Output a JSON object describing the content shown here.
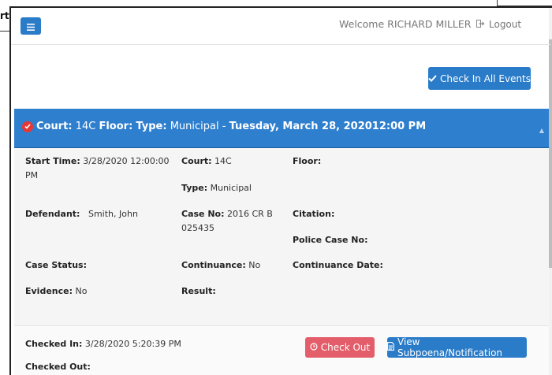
{
  "background": {
    "tab_fragment": "rt"
  },
  "header": {
    "welcome": "Welcome RICHARD MILLER",
    "logout_label": "Logout"
  },
  "actions": {
    "check_in_all": "Check In All Events"
  },
  "event": {
    "court_label": "Court:",
    "court": "14C",
    "floor_label": "Floor:",
    "type_label": "Type:",
    "type": "Municipal",
    "separator": "-",
    "datetime": "Tuesday, March 28, 202012:00 PM",
    "status_color": "#e53935"
  },
  "details": {
    "start_time_label": "Start Time:",
    "start_time_value": "3/28/2020  12:00:00",
    "start_time_value_2": "PM",
    "court_label": "Court:",
    "court_value": "14C",
    "floor_label": "Floor:",
    "type_label": "Type:",
    "type_value": "Municipal",
    "defendant_label": "Defendant:",
    "defendant_value": "Smith, John",
    "case_no_label": "Case No:",
    "case_no_value": "2016 CR B",
    "case_no_value_2": "025435",
    "citation_label": "Citation:",
    "police_case_label": "Police Case No:",
    "case_status_label": "Case Status:",
    "continuance_label": "Continuance:",
    "continuance_value": "No",
    "continuance_date_label": "Continuance Date:",
    "evidence_label": "Evidence:",
    "evidence_value": "No",
    "result_label": "Result:"
  },
  "footer": {
    "checked_in_label": "Checked In:",
    "checked_in_value": "3/28/2020  5:20:39 PM",
    "checked_out_label": "Checked Out:",
    "check_out_button": "Check Out",
    "view_subpoena_button": "View Subpoena/Notification"
  },
  "colors": {
    "primary": "#2a7bc8",
    "panel_header": "#2f7fcf",
    "danger": "#e35d6a"
  }
}
